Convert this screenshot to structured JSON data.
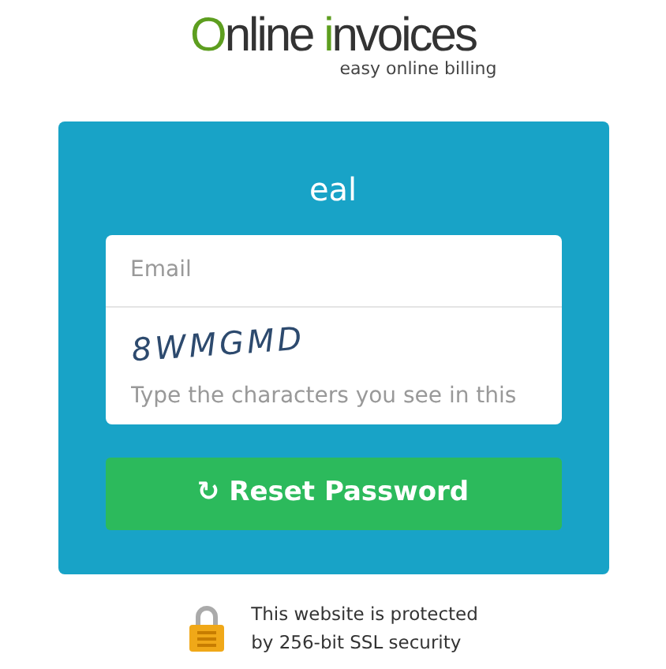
{
  "logo": {
    "parts": [
      {
        "text": "O",
        "accent": true
      },
      {
        "text": "nline ",
        "accent": false
      },
      {
        "text": "i",
        "accent": true
      },
      {
        "text": "nvoices",
        "accent": false
      }
    ],
    "tagline": "easy online billing"
  },
  "panel": {
    "title": "eal",
    "email": {
      "placeholder": "Email"
    },
    "captcha": {
      "text": "8WMGMD"
    },
    "captcha_input": {
      "placeholder": "Type the characters you see in this"
    },
    "button": {
      "icon": "↻",
      "label": "Reset Password"
    }
  },
  "security": {
    "lines": [
      "This website is protected",
      "by 256-bit SSL security"
    ]
  }
}
